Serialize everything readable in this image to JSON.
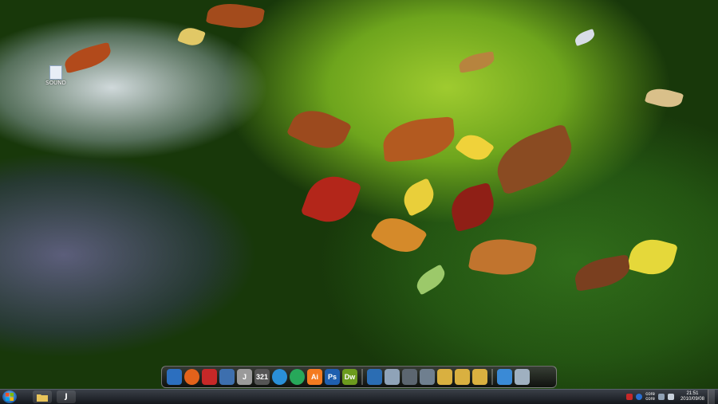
{
  "desktop": {
    "icon_label": "SOUND"
  },
  "dock": {
    "items": [
      {
        "icon": "internet-explorer-icon",
        "label": "",
        "color": "#2c6fbf"
      },
      {
        "icon": "firefox-icon",
        "label": "",
        "color": "#e2621b"
      },
      {
        "icon": "dashboard-icon",
        "label": "",
        "color": "#c62828"
      },
      {
        "icon": "contacts-icon",
        "label": "",
        "color": "#3d6fae"
      },
      {
        "icon": "text-editor-icon",
        "label": "J",
        "color": "#9a9a9a"
      },
      {
        "icon": "calendar-icon",
        "label": "321",
        "color": "#555555"
      },
      {
        "icon": "itunes-icon",
        "label": "",
        "color": "#2a8fd8"
      },
      {
        "icon": "media-player-icon",
        "label": "",
        "color": "#27a85a"
      },
      {
        "icon": "illustrator-icon",
        "label": "Ai",
        "color": "#f47b20"
      },
      {
        "icon": "photoshop-icon",
        "label": "Ps",
        "color": "#1f5faf"
      },
      {
        "icon": "dreamweaver-icon",
        "label": "Dw",
        "color": "#6c9b1e"
      },
      {
        "icon": "video-icon",
        "label": "",
        "color": "#2b6db3"
      },
      {
        "icon": "document-icon",
        "label": "",
        "color": "#8fa3b8"
      },
      {
        "icon": "camera-icon",
        "label": "",
        "color": "#5c6670"
      },
      {
        "icon": "preview-icon",
        "label": "",
        "color": "#6f7f8f"
      },
      {
        "icon": "folder-icon",
        "label": "",
        "color": "#d9b040"
      },
      {
        "icon": "folder-icon",
        "label": "",
        "color": "#d9b040"
      },
      {
        "icon": "folder-icon",
        "label": "",
        "color": "#d9b040"
      },
      {
        "icon": "settings-icon",
        "label": "",
        "color": "#3a8ad6"
      },
      {
        "icon": "trash-icon",
        "label": "",
        "color": "#9fb0c0"
      }
    ]
  },
  "taskbar": {
    "start_icon": "windows-start-icon",
    "pinned": [
      {
        "icon": "folder-icon"
      },
      {
        "icon": "text-editor-icon",
        "label": "J"
      }
    ],
    "tray": {
      "language_line1": "core",
      "language_line2": "core",
      "time": "21:51",
      "date": "2010/09/08"
    }
  }
}
